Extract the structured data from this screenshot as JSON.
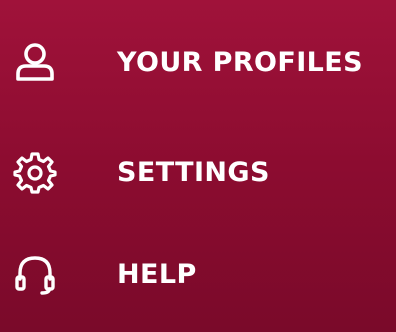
{
  "menu": {
    "items": [
      {
        "label": "YOUR PROFILES",
        "icon": "user-icon"
      },
      {
        "label": "SETTINGS",
        "icon": "gear-icon"
      },
      {
        "label": "HELP",
        "icon": "headset-icon"
      }
    ]
  },
  "colors": {
    "background": "#8c0c30",
    "text": "#ffffff"
  }
}
